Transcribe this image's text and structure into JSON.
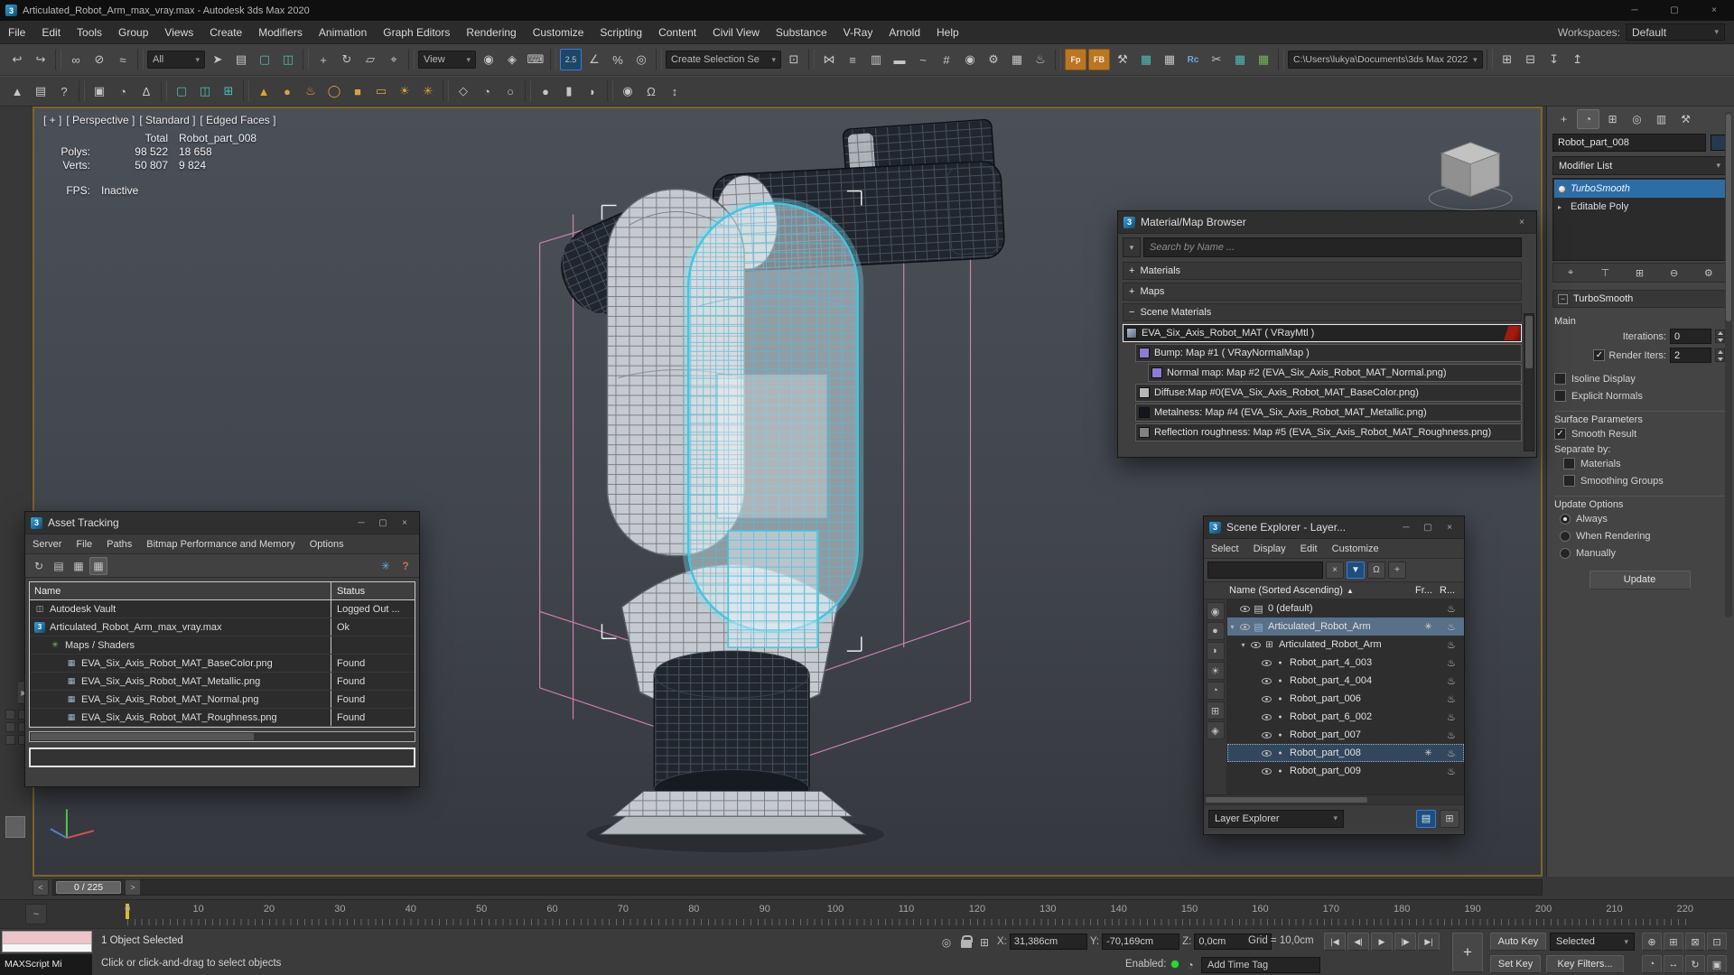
{
  "chrome": {
    "min": "─",
    "max": "▢",
    "close": "×"
  },
  "title_bar": {
    "title": "Articulated_Robot_Arm_max_vray.max - Autodesk 3ds Max 2020"
  },
  "menu_bar": {
    "items": [
      "File",
      "Edit",
      "Tools",
      "Group",
      "Views",
      "Create",
      "Modifiers",
      "Animation",
      "Graph Editors",
      "Rendering",
      "Customize",
      "Scripting",
      "Content",
      "Civil View",
      "Substance",
      "V-Ray",
      "Arnold",
      "Help"
    ],
    "workspaces_label": "Workspaces:",
    "workspaces_value": "Default"
  },
  "toolbar1": {
    "icons": [
      {
        "n": "undo-icon",
        "g": "↩"
      },
      {
        "n": "redo-icon",
        "g": "↪"
      },
      {
        "n": "separator",
        "c": "sep"
      },
      {
        "n": "select-link-icon",
        "g": "∞"
      },
      {
        "n": "unlink-icon",
        "g": "⊘"
      },
      {
        "n": "bind-spacewarp-icon",
        "g": "≈"
      },
      {
        "n": "separator",
        "c": "sep"
      },
      {
        "n": "selection-filter-combo",
        "g": "All",
        "c": "combo"
      },
      {
        "n": "select-object-icon",
        "g": "➤"
      },
      {
        "n": "select-by-name-icon",
        "g": "▤"
      },
      {
        "n": "rect-selection-region-icon",
        "g": "▢",
        "c": "teal"
      },
      {
        "n": "window-crossing-icon",
        "g": "◫",
        "c": "teal"
      },
      {
        "n": "separator",
        "c": "sep"
      },
      {
        "n": "select-move-icon",
        "g": "+"
      },
      {
        "n": "select-rotate-icon",
        "g": "↻"
      },
      {
        "n": "select-scale-icon",
        "g": "▱"
      },
      {
        "n": "select-place-icon",
        "g": "⌖"
      },
      {
        "n": "separator",
        "c": "sep"
      },
      {
        "n": "ref-coord-combo",
        "g": "View",
        "c": "combo"
      },
      {
        "n": "use-pivot-center-icon",
        "g": "◉"
      },
      {
        "n": "select-manipulate-icon",
        "g": "◈"
      },
      {
        "n": "kbd-override-icon",
        "g": "⌨"
      },
      {
        "n": "separator",
        "c": "sep"
      },
      {
        "n": "snaps-toggle-icon",
        "g": "2.5",
        "c": "active"
      },
      {
        "n": "angle-snap-icon",
        "g": "∠"
      },
      {
        "n": "percent-snap-icon",
        "g": "%"
      },
      {
        "n": "spinner-snap-icon",
        "g": "◎"
      },
      {
        "n": "separator",
        "c": "sep"
      },
      {
        "n": "named-selection-combo",
        "g": "Create Selection Se",
        "c": "combo wide"
      },
      {
        "n": "edit-named-selection-icon",
        "g": "⊡"
      },
      {
        "n": "separator",
        "c": "sep"
      },
      {
        "n": "mirror-icon",
        "g": "⋈"
      },
      {
        "n": "align-icon",
        "g": "≡"
      },
      {
        "n": "toggle-layer-explorer-icon",
        "g": "▥"
      },
      {
        "n": "toggle-ribbon-icon",
        "g": "▬"
      },
      {
        "n": "curve-editor-icon",
        "g": "~"
      },
      {
        "n": "schematic-view-icon",
        "g": "#"
      },
      {
        "n": "material-editor-icon",
        "g": "◉"
      },
      {
        "n": "render-setup-icon",
        "g": "⚙"
      },
      {
        "n": "rendered-frame-icon",
        "g": "▦"
      },
      {
        "n": "render-production-icon",
        "g": "♨"
      },
      {
        "n": "separator",
        "c": "sep"
      },
      {
        "n": "vray-fp-icon",
        "g": "Fp",
        "c": "orange"
      },
      {
        "n": "vray-fb-icon",
        "g": "FB",
        "c": "orange"
      },
      {
        "n": "hammer-icon",
        "g": "⚒"
      },
      {
        "n": "grid-snap-icon",
        "g": "▦",
        "c": "teal"
      },
      {
        "n": "data-table-icon",
        "g": "▦"
      },
      {
        "n": "vray-rc-icon",
        "g": "Rc",
        "c": "blue"
      },
      {
        "n": "scissors-icon",
        "g": "✂"
      },
      {
        "n": "teal-table-icon",
        "g": "▦",
        "c": "teal"
      },
      {
        "n": "green-table-icon",
        "g": "▦",
        "c": "green"
      },
      {
        "n": "separator",
        "c": "sep"
      },
      {
        "n": "project-path-combo",
        "g": "C:\\Users\\lukya\\Documents\\3ds Max 2022",
        "c": "combo path"
      },
      {
        "n": "separator",
        "c": "sep"
      },
      {
        "n": "asset-library-icon",
        "g": "⊞"
      },
      {
        "n": "open-explorer-icon",
        "g": "⊟"
      },
      {
        "n": "import-icon",
        "g": "↧"
      },
      {
        "n": "export-icon",
        "g": "↥"
      }
    ]
  },
  "toolbar2": {
    "icons": [
      {
        "n": "pyramid-icon",
        "g": "▲"
      },
      {
        "n": "notes-icon",
        "g": "▤"
      },
      {
        "n": "help-icon",
        "g": "?"
      },
      {
        "n": "separator",
        "c": "sep"
      },
      {
        "n": "paint-objects-icon",
        "g": "▣"
      },
      {
        "n": "populate-icon",
        "g": "◔"
      },
      {
        "n": "measure-icon",
        "g": "∆"
      },
      {
        "n": "separator",
        "c": "sep"
      },
      {
        "n": "region-set1-icon",
        "g": "▢",
        "c": "teal"
      },
      {
        "n": "region-set2-icon",
        "g": "◫",
        "c": "teal"
      },
      {
        "n": "region-set3-icon",
        "g": "⊞",
        "c": "teal"
      },
      {
        "n": "separator",
        "c": "sep"
      },
      {
        "n": "autogrid-cone-icon",
        "g": "▲",
        "c": "yellow"
      },
      {
        "n": "autogrid-sphere-icon",
        "g": "●",
        "c": "yellow"
      },
      {
        "n": "autogrid-teapot-icon",
        "g": "♨",
        "c": "yellow"
      },
      {
        "n": "autogrid-torus-icon",
        "g": "◯",
        "c": "yellow"
      },
      {
        "n": "autogrid-box-icon",
        "g": "■",
        "c": "yellow"
      },
      {
        "n": "autogrid-plane-icon",
        "g": "▭",
        "c": "yellow"
      },
      {
        "n": "daylight-icon",
        "g": "☀",
        "c": "yellow"
      },
      {
        "n": "compass-icon",
        "g": "✳",
        "c": "yellow"
      },
      {
        "n": "separator",
        "c": "sep"
      },
      {
        "n": "perspective-view-icon",
        "g": "◇"
      },
      {
        "n": "camera-view-icon",
        "g": "◔"
      },
      {
        "n": "light-view-icon",
        "g": "○"
      },
      {
        "n": "separator",
        "c": "sep"
      },
      {
        "n": "sphere-select-icon",
        "g": "●"
      },
      {
        "n": "cylinder-select-icon",
        "g": "▮"
      },
      {
        "n": "shapes-icon",
        "g": "◗"
      },
      {
        "n": "separator",
        "c": "sep"
      },
      {
        "n": "world-icon",
        "g": "◉"
      },
      {
        "n": "lock-axis-icon",
        "g": "Ω"
      },
      {
        "n": "mini-arrows-icon",
        "g": "↕"
      }
    ]
  },
  "viewport": {
    "label_segments": [
      "[ + ]",
      "[ Perspective ]",
      "[ Standard ]",
      "[ Edged Faces ]"
    ],
    "stats": {
      "h1": "Total",
      "h2": "Robot_part_008",
      "polys_label": "Polys:",
      "polys1": "98 522",
      "polys2": "18 658",
      "verts_label": "Verts:",
      "verts1": "50 807",
      "verts2": "9 824",
      "fps_label": "FPS:",
      "fps": "Inactive"
    }
  },
  "material_browser": {
    "title": "Material/Map Browser",
    "options_glyph": "▾",
    "search_placeholder": "Search by Name ...",
    "groups": [
      {
        "sign": "+",
        "label": "Materials"
      },
      {
        "sign": "+",
        "label": "Maps"
      },
      {
        "sign": "−",
        "label": "Scene Materials"
      }
    ],
    "entries": [
      {
        "sw": "sw-vray",
        "name": "EVA_Six_Axis_Robot_MAT  ( VRayMtl )",
        "cls": "selected"
      },
      {
        "sw": "sw-normal",
        "name": "Bump: Map #1  ( VRayNormalMap )",
        "cls": "ind1"
      },
      {
        "sw": "sw-normal",
        "name": "Normal map: Map #2 (EVA_Six_Axis_Robot_MAT_Normal.png)",
        "cls": "ind2"
      },
      {
        "sw": "sw-light",
        "name": "Diffuse:Map #0(EVA_Six_Axis_Robot_MAT_BaseColor.png)",
        "cls": "ind1"
      },
      {
        "sw": "sw-dark",
        "name": "Metalness: Map #4 (EVA_Six_Axis_Robot_MAT_Metallic.png)",
        "cls": "ind1"
      },
      {
        "sw": "sw-mid",
        "name": "Reflection roughness: Map #5 (EVA_Six_Axis_Robot_MAT_Roughness.png)",
        "cls": "ind1"
      }
    ]
  },
  "asset_tracking": {
    "title": "Asset Tracking",
    "menu": [
      "Server",
      "File",
      "Paths",
      "Bitmap Performance and Memory",
      "Options"
    ],
    "toolbar_left": [
      {
        "n": "asset-refresh-icon",
        "g": "↻"
      },
      {
        "n": "asset-list-view-icon",
        "g": "▤"
      },
      {
        "n": "asset-thumb-view-icon",
        "g": "▦"
      },
      {
        "n": "asset-table-view-icon",
        "g": "▦",
        "c": "active"
      }
    ],
    "toolbar_right": [
      {
        "n": "asset-update-bitmaps-icon",
        "g": "✳",
        "c": "blue"
      },
      {
        "n": "asset-help-icon",
        "g": "?",
        "c": "red"
      }
    ],
    "columns": {
      "name": "Name",
      "status": "Status"
    },
    "rows": [
      {
        "icon": "ai-vault",
        "name": "Autodesk Vault",
        "status": "Logged Out ...",
        "cls": ""
      },
      {
        "icon": "ai-max",
        "name": "Articulated_Robot_Arm_max_vray.max",
        "status": "Ok",
        "cls": ""
      },
      {
        "icon": "ai-shader",
        "name": "Maps / Shaders",
        "status": "",
        "cls": "ind1"
      },
      {
        "icon": "ai-bmp",
        "name": "EVA_Six_Axis_Robot_MAT_BaseColor.png",
        "status": "Found",
        "cls": "ind2"
      },
      {
        "icon": "ai-bmp",
        "name": "EVA_Six_Axis_Robot_MAT_Metallic.png",
        "status": "Found",
        "cls": "ind2"
      },
      {
        "icon": "ai-bmp",
        "name": "EVA_Six_Axis_Robot_MAT_Normal.png",
        "status": "Found",
        "cls": "ind2"
      },
      {
        "icon": "ai-bmp",
        "name": "EVA_Six_Axis_Robot_MAT_Roughness.png",
        "status": "Found",
        "cls": "ind2"
      }
    ]
  },
  "scene_explorer": {
    "title": "Scene Explorer - Layer...",
    "menu": [
      "Select",
      "Display",
      "Edit",
      "Customize"
    ],
    "search": {
      "clear": "×",
      "filter": "▼",
      "lock": "Ω",
      "add": "+"
    },
    "header": {
      "name": "Name (Sorted Ascending)",
      "sort_arrow": "▲",
      "fr": "Fr...",
      "r": "R..."
    },
    "rail": [
      {
        "n": "display-all-icon",
        "g": "◉"
      },
      {
        "n": "display-geometry-icon",
        "g": "●"
      },
      {
        "n": "display-shapes-icon",
        "g": "◗"
      },
      {
        "n": "display-lights-icon",
        "g": "☀"
      },
      {
        "n": "display-cameras-icon",
        "g": "◔"
      },
      {
        "n": "display-helpers-icon",
        "g": "⊞"
      },
      {
        "n": "display-materials-icon",
        "g": "◈"
      }
    ],
    "rows": [
      {
        "exp": "",
        "icon": "ic-layer",
        "name": "0 (default)",
        "cls": "",
        "fr": "",
        "r": "♨"
      },
      {
        "exp": "▾",
        "icon": "ic-layer-blue",
        "name": "Articulated_Robot_Arm",
        "cls": "selected",
        "fr": "✳",
        "r": "♨"
      },
      {
        "exp": "▾",
        "icon": "ic-group",
        "name": "Articulated_Robot_Arm",
        "cls": "ind1",
        "fr": "",
        "r": "♨"
      },
      {
        "exp": "",
        "icon": "ic-geom",
        "name": "Robot_part_4_003",
        "cls": "ind2",
        "fr": "",
        "r": "♨"
      },
      {
        "exp": "",
        "icon": "ic-geom",
        "name": "Robot_part_4_004",
        "cls": "ind2",
        "fr": "",
        "r": "♨"
      },
      {
        "exp": "",
        "icon": "ic-geom",
        "name": "Robot_part_006",
        "cls": "ind2",
        "fr": "",
        "r": "♨"
      },
      {
        "exp": "",
        "icon": "ic-geom",
        "name": "Robot_part_6_002",
        "cls": "ind2",
        "fr": "",
        "r": "♨"
      },
      {
        "exp": "",
        "icon": "ic-geom",
        "name": "Robot_part_007",
        "cls": "ind2",
        "fr": "",
        "r": "♨"
      },
      {
        "exp": "",
        "icon": "ic-geom",
        "name": "Robot_part_008",
        "cls": "ind2 current",
        "fr": "✳",
        "r": "♨"
      },
      {
        "exp": "",
        "icon": "ic-geom",
        "name": "Robot_part_009",
        "cls": "ind2",
        "fr": "",
        "r": "♨"
      }
    ],
    "footer": {
      "combo": "Layer Explorer"
    }
  },
  "command_panel": {
    "tabs": [
      {
        "n": "create-tab-icon",
        "g": "+"
      },
      {
        "n": "modify-tab-icon",
        "g": "◔",
        "c": "active"
      },
      {
        "n": "hierarchy-tab-icon",
        "g": "⊞"
      },
      {
        "n": "motion-tab-icon",
        "g": "◎"
      },
      {
        "n": "display-tab-icon",
        "g": "▥"
      },
      {
        "n": "utilities-tab-icon",
        "g": "⚒"
      }
    ],
    "object_name": "Robot_part_008",
    "modifier_list_label": "Modifier List",
    "stack_expand": "▸",
    "stack0": "TurboSmooth",
    "stack1": "Editable Poly",
    "stack_footer": [
      {
        "n": "pin-stack-icon",
        "g": "⌖"
      },
      {
        "n": "show-end-result-icon",
        "g": "⊤"
      },
      {
        "n": "make-unique-icon",
        "g": "⊞"
      },
      {
        "n": "remove-modifier-icon",
        "g": "⊖"
      },
      {
        "n": "configure-sets-icon",
        "g": "⚙"
      }
    ],
    "rollout_title": "TurboSmooth",
    "rollout_collapse": "−",
    "group_main": "Main",
    "iterations_label": "Iterations:",
    "iterations_value": "0",
    "render_iters_label": "Render Iters:",
    "render_iters_value": "2",
    "isoline_label": "Isoline Display",
    "explicit_label": "Explicit Normals",
    "surface_params_label": "Surface Parameters",
    "smooth_result_label": "Smooth Result",
    "separate_by_label": "Separate by:",
    "materials_label": "Materials",
    "smoothing_groups_label": "Smoothing Groups",
    "update_options_label": "Update Options",
    "always_label": "Always",
    "when_rendering_label": "When Rendering",
    "manually_label": "Manually",
    "update_button": "Update"
  },
  "timeline": {
    "frame_display": "0 / 225",
    "prev": "<",
    "next": ">"
  },
  "ruler": {
    "curve_glyph": "~",
    "numbers": [
      "0",
      "10",
      "20",
      "30",
      "40",
      "50",
      "60",
      "70",
      "80",
      "90",
      "100",
      "110",
      "120",
      "130",
      "140",
      "150",
      "160",
      "170",
      "180",
      "190",
      "200",
      "210",
      "220"
    ]
  },
  "status_bar": {
    "maxscript_label": "MAXScript Mi",
    "selected_info": "1 Object Selected",
    "prompt": "Click or click-and-drag to select objects",
    "isolate_glyph": "◎",
    "axis_glyph": "⊞",
    "x_label": "X:",
    "x_value": "31,386cm",
    "y_label": "Y:",
    "y_value": "-70,169cm",
    "z_label": "Z:",
    "z_value": "0,0cm",
    "grid_label": "Grid = 10,0cm",
    "playback": [
      {
        "n": "go-start-button",
        "g": "|◀"
      },
      {
        "n": "prev-frame-button",
        "g": "◀|"
      },
      {
        "n": "play-button",
        "g": "▶"
      },
      {
        "n": "next-frame-button",
        "g": "|▶"
      },
      {
        "n": "go-end-button",
        "g": "▶|"
      }
    ],
    "set_keys_plus": "+",
    "auto_key": "Auto Key",
    "selection_set": "Selected",
    "enabled_label": "Enabled:",
    "clock_glyph": "◔",
    "add_time_tag": "Add Time Tag",
    "set_key": "Set Key",
    "key_filters": "Key Filters...",
    "nav_row1": [
      {
        "n": "zoom-icon",
        "g": "⊕"
      },
      {
        "n": "zoom-window-icon",
        "g": "⊞"
      },
      {
        "n": "zoom-extents-icon",
        "g": "⊠"
      },
      {
        "n": "zoom-region-icon",
        "g": "⊡"
      }
    ],
    "nav_row2": [
      {
        "n": "fov-icon",
        "g": "◔"
      },
      {
        "n": "pan-icon",
        "g": "↔"
      },
      {
        "n": "orbit-icon",
        "g": "↻"
      },
      {
        "n": "maximize-viewport-icon",
        "g": "▣"
      }
    ]
  },
  "colors": {
    "accent_blue": "#3a7bd5",
    "selection_cyan": "#45c5de",
    "vray_orange": "#b97623",
    "guide_pink": "#e08cc0",
    "maxscript_pink": "#edc4c9",
    "viewport_border_gold": "#7d6428"
  }
}
